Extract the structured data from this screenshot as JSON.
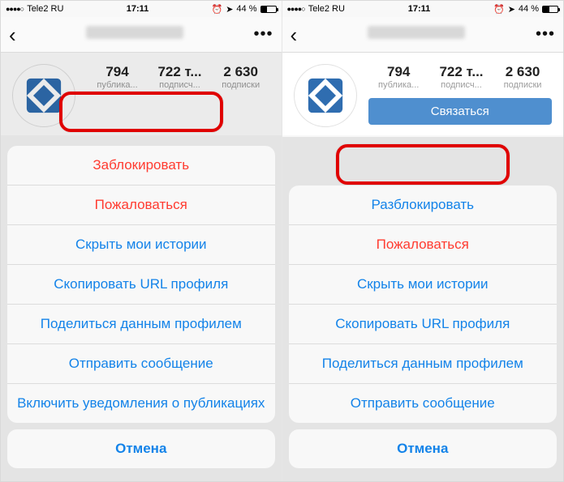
{
  "status": {
    "signal": "●●●●○",
    "carrier": "Tele2 RU",
    "time": "17:11",
    "battery_pct": "44 %"
  },
  "profile": {
    "stats": [
      {
        "n": "794",
        "l": "публика..."
      },
      {
        "n": "722 т...",
        "l": "подписч..."
      },
      {
        "n": "2 630",
        "l": "подписки"
      }
    ],
    "contact": "Связаться"
  },
  "sheet_left": {
    "items": [
      {
        "label": "Заблокировать",
        "cls": "c-red",
        "name": "sheet-block"
      },
      {
        "label": "Пожаловаться",
        "cls": "c-red",
        "name": "sheet-report"
      },
      {
        "label": "Скрыть мои истории",
        "cls": "c-blue",
        "name": "sheet-hide-stories"
      },
      {
        "label": "Скопировать URL профиля",
        "cls": "c-blue",
        "name": "sheet-copy-url"
      },
      {
        "label": "Поделиться данным профилем",
        "cls": "c-blue",
        "name": "sheet-share-profile"
      },
      {
        "label": "Отправить сообщение",
        "cls": "c-blue",
        "name": "sheet-send-message"
      },
      {
        "label": "Включить уведомления о публикациях",
        "cls": "c-blue",
        "name": "sheet-enable-notifications"
      }
    ],
    "cancel": "Отмена"
  },
  "sheet_right": {
    "items": [
      {
        "label": "Разблокировать",
        "cls": "c-blue",
        "name": "sheet-unblock"
      },
      {
        "label": "Пожаловаться",
        "cls": "c-red",
        "name": "sheet-report"
      },
      {
        "label": "Скрыть мои истории",
        "cls": "c-blue",
        "name": "sheet-hide-stories"
      },
      {
        "label": "Скопировать URL профиля",
        "cls": "c-blue",
        "name": "sheet-copy-url"
      },
      {
        "label": "Поделиться данным профилем",
        "cls": "c-blue",
        "name": "sheet-share-profile"
      },
      {
        "label": "Отправить сообщение",
        "cls": "c-blue",
        "name": "sheet-send-message"
      }
    ],
    "cancel": "Отмена"
  }
}
